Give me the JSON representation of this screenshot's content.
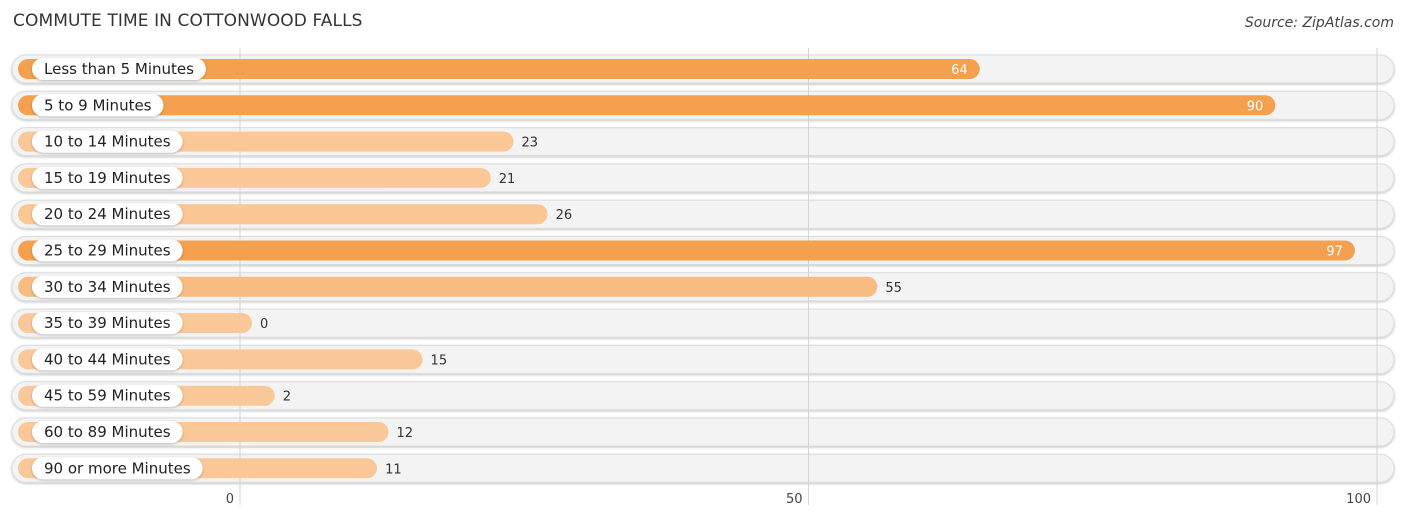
{
  "title": "COMMUTE TIME IN COTTONWOOD FALLS",
  "source": "Source: ZipAtlas.com",
  "chart_data": {
    "type": "bar",
    "orientation": "horizontal",
    "title": "COMMUTE TIME IN COTTONWOOD FALLS",
    "xlabel": "",
    "ylabel": "",
    "xlim": [
      0,
      100
    ],
    "xticks": [
      0,
      50,
      100
    ],
    "grid": true,
    "categories": [
      "Less than 5 Minutes",
      "5 to 9 Minutes",
      "10 to 14 Minutes",
      "15 to 19 Minutes",
      "20 to 24 Minutes",
      "25 to 29 Minutes",
      "30 to 34 Minutes",
      "35 to 39 Minutes",
      "40 to 44 Minutes",
      "45 to 59 Minutes",
      "60 to 89 Minutes",
      "90 or more Minutes"
    ],
    "values": [
      64,
      90,
      23,
      21,
      26,
      97,
      55,
      0,
      15,
      2,
      12,
      11
    ],
    "colors": {
      "strong": "#f5a04f",
      "light": "#fac898",
      "track": "#f3f3f3"
    }
  }
}
